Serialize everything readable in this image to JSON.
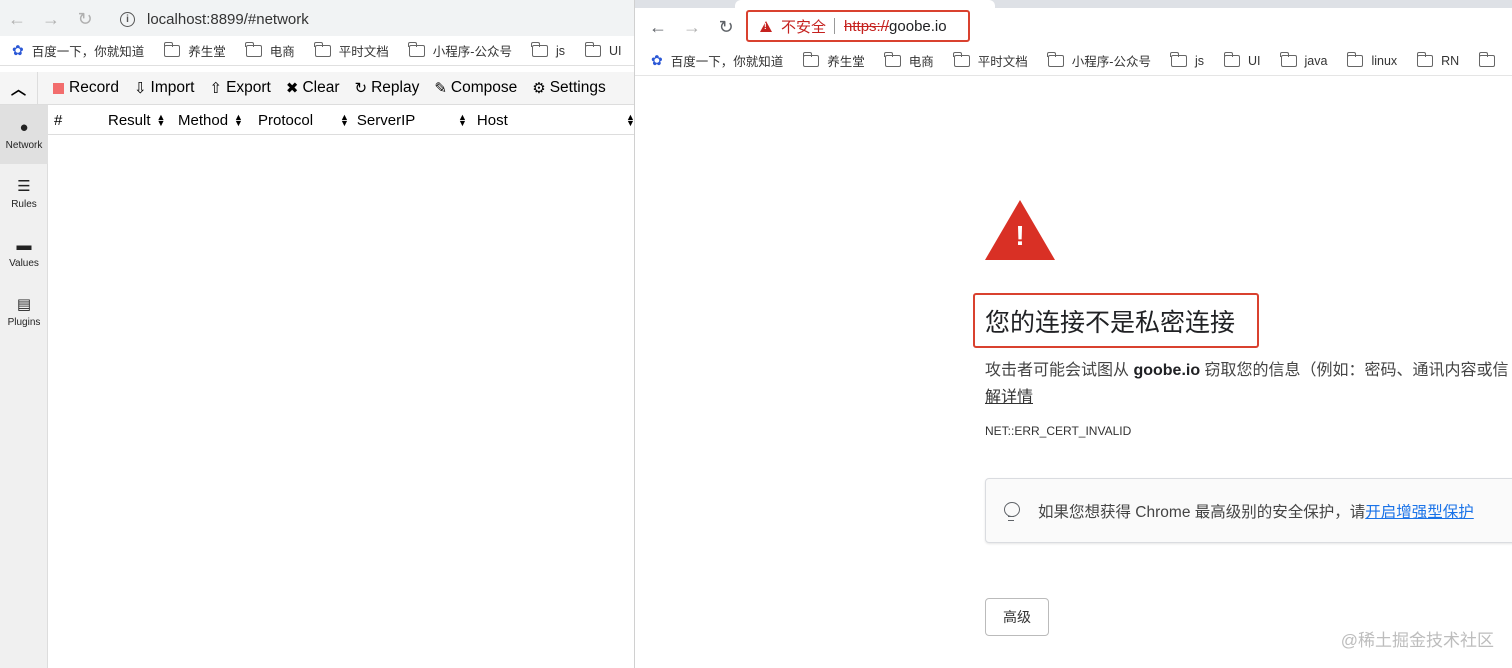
{
  "left": {
    "url": "localhost:8899/#network",
    "bookmarks": [
      "百度一下，你就知道",
      "养生堂",
      "电商",
      "平时文档",
      "小程序-公众号",
      "js",
      "UI"
    ],
    "toolbar": {
      "record": "Record",
      "import": "Import",
      "export": "Export",
      "clear": "Clear",
      "replay": "Replay",
      "compose": "Compose",
      "settings": "Settings"
    },
    "sidebar": [
      "Network",
      "Rules",
      "Values",
      "Plugins"
    ],
    "columns": [
      "#",
      "Result",
      "Method",
      "Protocol",
      "ServerIP",
      "Host"
    ]
  },
  "right": {
    "insecure_label": "不安全",
    "url_scheme": "https://",
    "url_host": "goobe.io",
    "bookmarks": [
      "百度一下，你就知道",
      "养生堂",
      "电商",
      "平时文档",
      "小程序-公众号",
      "js",
      "UI",
      "java",
      "linux",
      "RN"
    ],
    "title": "您的连接不是私密连接",
    "desc_prefix": "攻击者可能会试图从 ",
    "desc_host": "goobe.io",
    "desc_suffix": " 窃取您的信息（例如：密码、通讯内容或信",
    "learn_more": "解详情",
    "error_code": "NET::ERR_CERT_INVALID",
    "tip_text": "如果您想获得 Chrome 最高级别的安全保护，请",
    "tip_link": "开启增强型保护",
    "advanced": "高级",
    "watermark": "@稀土掘金技术社区"
  },
  "colors": {
    "danger": "#d93025",
    "link": "#1a73e8",
    "record": "#f26d6d"
  }
}
